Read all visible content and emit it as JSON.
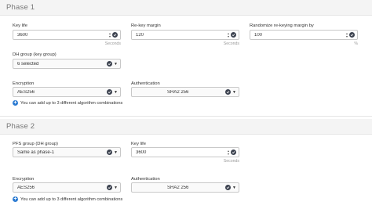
{
  "phase1": {
    "title": "Phase 1",
    "key_life": {
      "label": "Key life",
      "value": "3600",
      "unit": "Seconds"
    },
    "rekey_margin": {
      "label": "Re-key margin",
      "value": "120",
      "unit": "Seconds"
    },
    "randomize": {
      "label": "Randomize re-keying margin by",
      "value": "100",
      "unit": "%"
    },
    "dh_group": {
      "label": "DH group (key group)",
      "value": "6 selected"
    },
    "encryption": {
      "label": "Encryption",
      "value": "AES256"
    },
    "authentication": {
      "label": "Authentication",
      "value": "SHA2 256"
    },
    "add_link": "You can add up to 3 different algorithm combinations"
  },
  "phase2": {
    "title": "Phase 2",
    "pfs_group": {
      "label": "PFS group (DH group)",
      "value": "Same as phase-1"
    },
    "key_life": {
      "label": "Key life",
      "value": "3600",
      "unit": "Seconds"
    },
    "encryption": {
      "label": "Encryption",
      "value": "AES256"
    },
    "authentication": {
      "label": "Authentication",
      "value": "SHA2 256"
    },
    "add_link": "You can add up to 3 different algorithm combinations"
  }
}
